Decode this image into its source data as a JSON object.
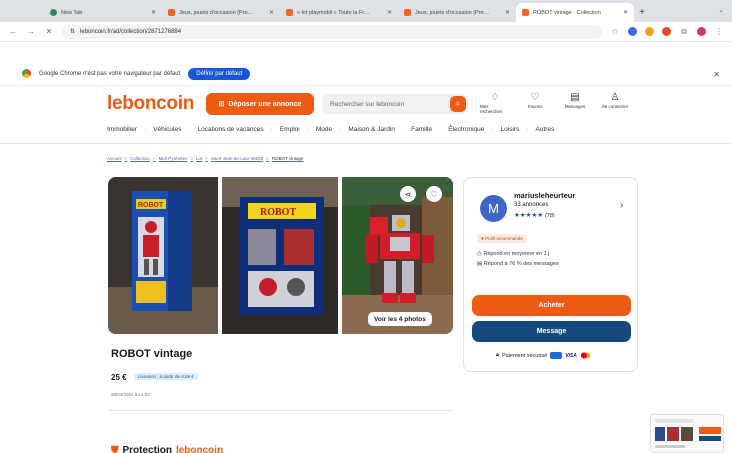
{
  "browser": {
    "tabs": [
      {
        "title": "New Tab",
        "favicon": "chrome-icon",
        "active": false
      },
      {
        "title": "Jeux, jouets d'occasion (Pro…",
        "favicon": "leboncoin-icon",
        "active": false
      },
      {
        "title": "« lot playmobil » Toute la Fr…",
        "favicon": "leboncoin-icon",
        "active": false
      },
      {
        "title": "Jeux, jouets d'occasion (Pro…",
        "favicon": "leboncoin-icon",
        "active": false
      },
      {
        "title": "ROBOT vintage - Collection",
        "favicon": "leboncoin-icon",
        "active": true
      }
    ],
    "url": "leboncoin.fr/ad/collection/2871276884",
    "infobar_text": "Google Chrome n'est pas votre navigateur par défaut",
    "infobar_button": "Définir par défaut"
  },
  "header": {
    "logo": "leboncoin",
    "post_button": "Déposer une annonce",
    "search_placeholder": "Rechercher sur leboncoin",
    "icons": [
      {
        "label": "Mes recherches",
        "glyph": "♢"
      },
      {
        "label": "Favoris",
        "glyph": "♡"
      },
      {
        "label": "Messages",
        "glyph": "▤"
      },
      {
        "label": "Se connecter",
        "glyph": "♙"
      }
    ]
  },
  "categories": [
    "Immobilier",
    "Véhicules",
    "Locations de vacances",
    "Emploi",
    "Mode",
    "Maison & Jardin",
    "Famille",
    "Électronique",
    "Loisirs",
    "Autres"
  ],
  "breadcrumb": [
    "Accueil",
    "Collection",
    "Midi-Pyrénées",
    "Lot",
    "Saint-Jean-de-Laur 46260",
    "ROBOT vintage"
  ],
  "gallery": {
    "see_all": "Voir les 4 photos",
    "box_label": "ROBOT"
  },
  "ad": {
    "title": "ROBOT vintage",
    "price": "25 €",
    "delivery": "Livraison : à partir de 4,59 €",
    "date": "28/03/2024 à 14:02"
  },
  "seller": {
    "initial": "M",
    "name": "mariusleheurteur",
    "ads_count": "33 annonces",
    "stars": "★★★★★",
    "reviews": "(78)",
    "badge": "Profil recommandé",
    "response_time": "Répond en moyenne en 1 j",
    "response_rate": "Répond à 76 % des messages",
    "buy_button": "Acheter",
    "message_button": "Message",
    "payment": "Paiement sécurisé",
    "visa": "VISA"
  },
  "protection": {
    "label": "Protection",
    "brand": "leboncoin"
  },
  "colors": {
    "brand": "#ec5a13",
    "navy": "#174a7c"
  }
}
